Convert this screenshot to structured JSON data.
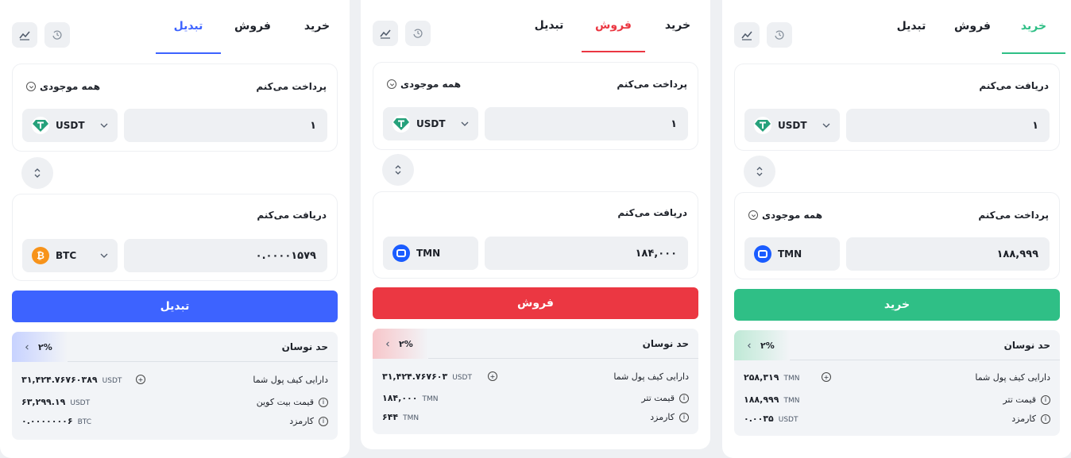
{
  "tabs": {
    "buy": "خرید",
    "sell": "فروش",
    "convert": "تبدیل"
  },
  "colors": {
    "convert": "#3d63ff",
    "sell": "#eb3742",
    "buy": "#2fbf86"
  },
  "labels": {
    "pay": "پرداخت می‌کنم",
    "receive": "دریافت می‌کنم",
    "all_balance": "همه موجودی",
    "slippage": "حد نوسان",
    "wallet_balance": "دارایی کیف پول شما",
    "fee": "کارمزد",
    "btc_price": "قیمت بیت کوین",
    "usdt_price": "قیمت تتر"
  },
  "convert_panel": {
    "pay_amount": "۱",
    "pay_currency": "USDT",
    "receive_amount": "۰.۰۰۰۰۱۵۷۹",
    "receive_currency": "BTC",
    "action": "تبدیل",
    "slippage": "۲%",
    "wallet_value": "۳۱,۴۲۴.۷۶۷۶۰۳۸۹",
    "wallet_unit": "USDT",
    "price_value": "۶۳,۲۹۹.۱۹",
    "price_unit": "USDT",
    "fee_value": "۰.۰۰۰۰۰۰۰۶",
    "fee_unit": "BTC"
  },
  "sell_panel": {
    "pay_amount": "۱",
    "pay_currency": "USDT",
    "receive_amount": "۱۸۴,۰۰۰",
    "receive_currency": "TMN",
    "action": "فروش",
    "slippage": "۲%",
    "wallet_value": "۳۱,۴۲۴.۷۶۷۶۰۳",
    "wallet_unit": "USDT",
    "price_value": "۱۸۴,۰۰۰",
    "price_unit": "TMN",
    "fee_value": "۶۴۴",
    "fee_unit": "TMN"
  },
  "buy_panel": {
    "receive_amount": "۱",
    "receive_currency": "USDT",
    "pay_amount": "۱۸۸,۹۹۹",
    "pay_currency": "TMN",
    "action": "خرید",
    "slippage": "۲%",
    "wallet_value": "۲۵۸,۳۱۹",
    "wallet_unit": "TMN",
    "price_value": "۱۸۸,۹۹۹",
    "price_unit": "TMN",
    "fee_value": "۰.۰۰۳۵",
    "fee_unit": "USDT"
  }
}
